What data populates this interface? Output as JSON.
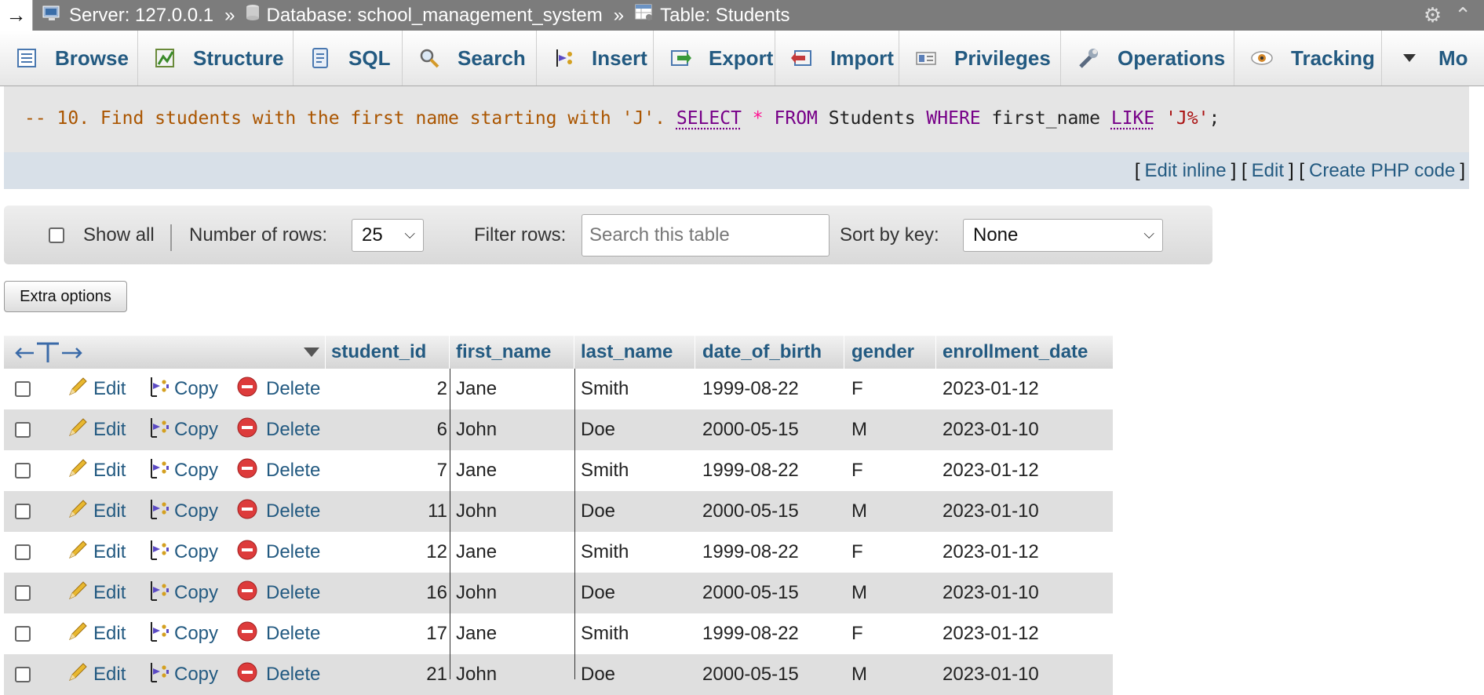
{
  "breadcrumb": {
    "server": "Server: 127.0.0.1",
    "database": "Database: school_management_system",
    "table": "Table: Students",
    "separator": "»"
  },
  "tabs": [
    {
      "label": "Browse",
      "icon": "browse-icon"
    },
    {
      "label": "Structure",
      "icon": "structure-icon"
    },
    {
      "label": "SQL",
      "icon": "sql-icon"
    },
    {
      "label": "Search",
      "icon": "search-icon"
    },
    {
      "label": "Insert",
      "icon": "insert-icon"
    },
    {
      "label": "Export",
      "icon": "export-icon"
    },
    {
      "label": "Import",
      "icon": "import-icon"
    },
    {
      "label": "Privileges",
      "icon": "privileges-icon"
    },
    {
      "label": "Operations",
      "icon": "operations-icon"
    },
    {
      "label": "Tracking",
      "icon": "tracking-icon"
    },
    {
      "label": "Mo",
      "icon": "dropdown-icon"
    }
  ],
  "sql": {
    "comment": "-- 10. Find students with the first name starting with 'J'.",
    "select": "SELECT",
    "star": "*",
    "from": "FROM",
    "table": "Students",
    "where": "WHERE",
    "column": "first_name",
    "like": "LIKE",
    "pattern": "'J%'",
    "end": ";"
  },
  "edit_links": {
    "edit_inline": "Edit inline",
    "edit": "Edit",
    "create_php": "Create PHP code"
  },
  "filter": {
    "show_all": "Show all",
    "rows_label": "Number of rows:",
    "rows_value": "25",
    "filter_label": "Filter rows:",
    "filter_placeholder": "Search this table",
    "sort_label": "Sort by key:",
    "sort_value": "None"
  },
  "extra_options": "Extra options",
  "table": {
    "columns": [
      "student_id",
      "first_name",
      "last_name",
      "date_of_birth",
      "gender",
      "enrollment_date"
    ],
    "actions": {
      "edit": "Edit",
      "copy": "Copy",
      "delete": "Delete"
    },
    "rows": [
      {
        "student_id": "2",
        "first_name": "Jane",
        "last_name": "Smith",
        "date_of_birth": "1999-08-22",
        "gender": "F",
        "enrollment_date": "2023-01-12"
      },
      {
        "student_id": "6",
        "first_name": "John",
        "last_name": "Doe",
        "date_of_birth": "2000-05-15",
        "gender": "M",
        "enrollment_date": "2023-01-10"
      },
      {
        "student_id": "7",
        "first_name": "Jane",
        "last_name": "Smith",
        "date_of_birth": "1999-08-22",
        "gender": "F",
        "enrollment_date": "2023-01-12"
      },
      {
        "student_id": "11",
        "first_name": "John",
        "last_name": "Doe",
        "date_of_birth": "2000-05-15",
        "gender": "M",
        "enrollment_date": "2023-01-10"
      },
      {
        "student_id": "12",
        "first_name": "Jane",
        "last_name": "Smith",
        "date_of_birth": "1999-08-22",
        "gender": "F",
        "enrollment_date": "2023-01-12"
      },
      {
        "student_id": "16",
        "first_name": "John",
        "last_name": "Doe",
        "date_of_birth": "2000-05-15",
        "gender": "M",
        "enrollment_date": "2023-01-10"
      },
      {
        "student_id": "17",
        "first_name": "Jane",
        "last_name": "Smith",
        "date_of_birth": "1999-08-22",
        "gender": "F",
        "enrollment_date": "2023-01-12"
      },
      {
        "student_id": "21",
        "first_name": "John",
        "last_name": "Doe",
        "date_of_birth": "2000-05-15",
        "gender": "M",
        "enrollment_date": "2023-01-10"
      }
    ]
  }
}
